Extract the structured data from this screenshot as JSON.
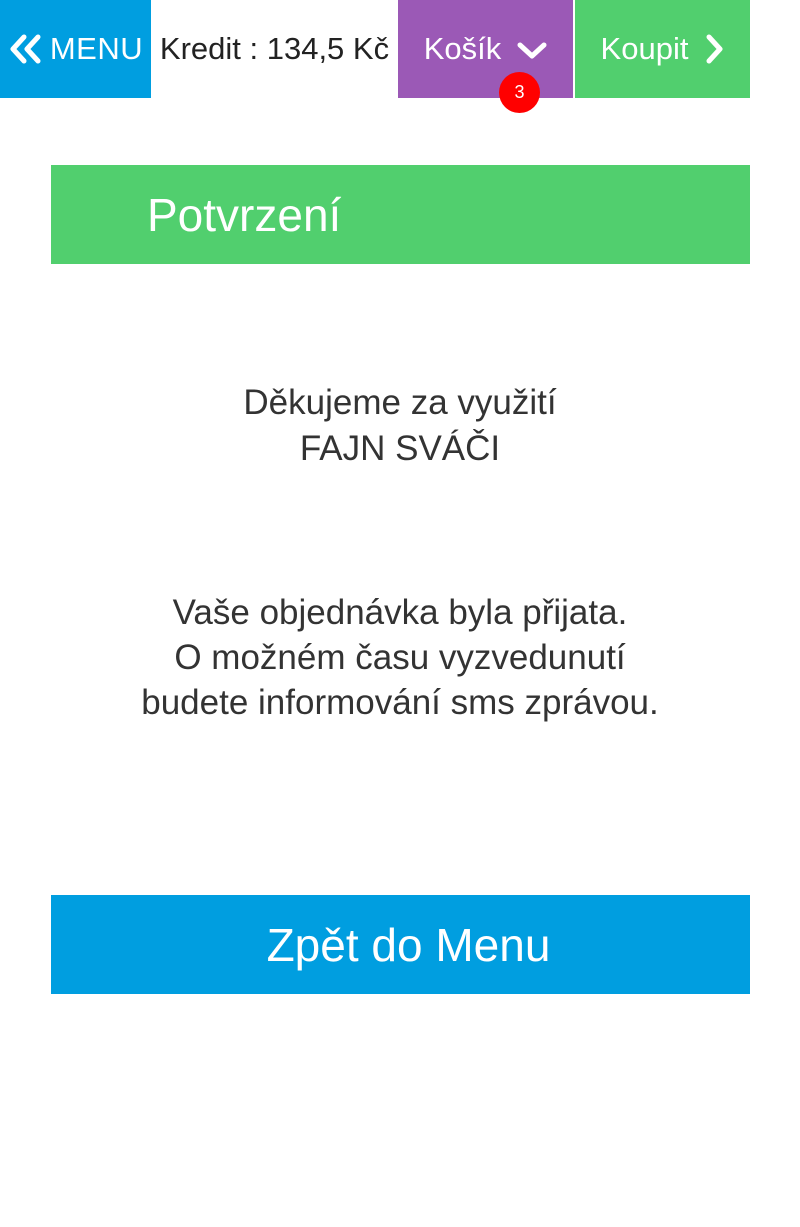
{
  "topbar": {
    "menu_label": "MENU",
    "menu_icon": "double-chevron-left-icon",
    "credit_text": "Kredit : 134,5 Kč",
    "cart_label": "Košík",
    "cart_icon": "chevron-down-icon",
    "cart_count": "3",
    "buy_label": "Koupit",
    "buy_icon": "chevron-right-icon"
  },
  "main": {
    "header_title": "Potvrzení",
    "thanks_line1": "Děkujeme za využití",
    "thanks_line2": "FAJN SVÁČI",
    "order_line1": "Vaše objednávka byla přijata.",
    "order_line2": "O možném času vyzvedunutí",
    "order_line3": "budete informování sms zprávou.",
    "back_button_label": "Zpět do Menu"
  },
  "colors": {
    "blue": "#009ee0",
    "purple": "#9b59b6",
    "green": "#51cf6e",
    "badge_red": "#ff0000",
    "text": "#333333"
  }
}
